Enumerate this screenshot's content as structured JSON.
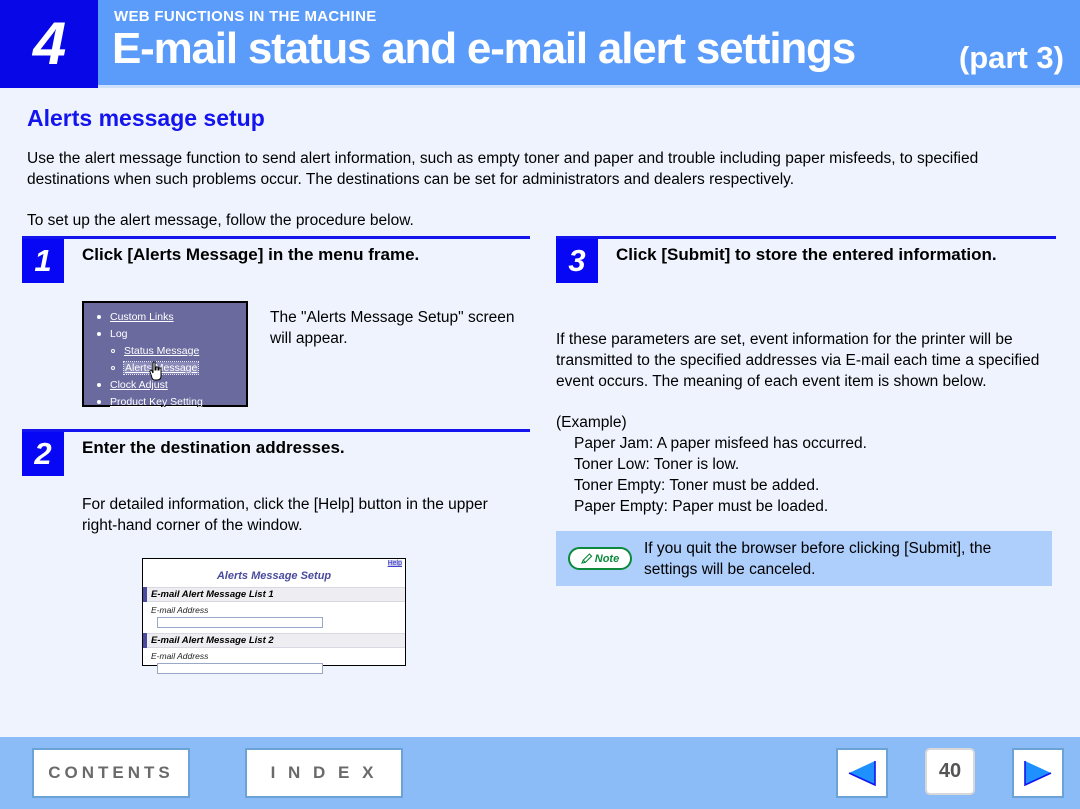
{
  "header": {
    "chapter_number": "4",
    "kicker": "WEB FUNCTIONS IN THE MACHINE",
    "title": "E-mail status and e-mail alert settings",
    "part": "(part 3)",
    "chapter_box_color": "#0707e8",
    "banner_color": "#5b9cfb"
  },
  "section": {
    "title": "Alerts message setup",
    "title_color": "#1414ef",
    "intro": "Use the alert message function to send alert information, such as empty toner and paper and trouble including paper misfeeds, to specified destinations when such problems occur. The destinations can be set for administrators and dealers respectively.",
    "intro2": "To set up the alert message, follow the procedure below."
  },
  "steps": {
    "step1": {
      "number": "1",
      "heading": "Click [Alerts Message] in the menu frame.",
      "caption": "The \"Alerts Message Setup\" screen will appear."
    },
    "step2": {
      "number": "2",
      "heading": "Enter the destination addresses.",
      "body": "For detailed information, click the [Help] button in the upper right-hand corner of the window."
    },
    "step3": {
      "number": "3",
      "heading": "Click [Submit] to store the entered information.",
      "body": "If these parameters are set, event information for the printer will be transmitted to the specified addresses via E-mail each time a specified event occurs. The meaning of each event item is shown below."
    }
  },
  "menu_frame": {
    "background_color": "#6a6a9e",
    "items": [
      {
        "label": "Custom Links",
        "level": "top",
        "link": true,
        "focused": false
      },
      {
        "label": "Log",
        "level": "top",
        "link": false,
        "focused": false
      },
      {
        "label": "Status Message",
        "level": "sub",
        "link": true,
        "focused": false
      },
      {
        "label": "Alerts Message",
        "level": "sub",
        "link": true,
        "focused": true
      },
      {
        "label": "Clock Adjust",
        "level": "top",
        "link": true,
        "focused": false
      },
      {
        "label": "Product Key Setting",
        "level": "top",
        "link": true,
        "focused": false
      }
    ]
  },
  "dialog": {
    "help_label": "Help",
    "title": "Alerts Message Setup",
    "sections": [
      {
        "heading": "E-mail Alert Message List 1",
        "field_label": "E-mail Address",
        "field_value": ""
      },
      {
        "heading": "E-mail Alert Message List 2",
        "field_label": "E-mail Address",
        "field_value": ""
      }
    ]
  },
  "example": {
    "title": "(Example)",
    "items": [
      "Paper Jam: A paper misfeed has occurred.",
      "Toner Low: Toner is low.",
      "Toner Empty: Toner must be added.",
      "Paper Empty: Paper must be loaded."
    ]
  },
  "note": {
    "label": "Note",
    "icon": "pencil-icon",
    "text": "If you quit the browser before clicking [Submit], the settings will be canceled.",
    "accent_color": "#0b8a3c",
    "background_color": "#aecefb"
  },
  "footer": {
    "contents_label": "CONTENTS",
    "index_label": "I N D E X",
    "page_number": "40",
    "prev_icon": "previous-page-arrow-icon",
    "next_icon": "next-page-arrow-icon",
    "background_color": "#8cbcf7"
  }
}
